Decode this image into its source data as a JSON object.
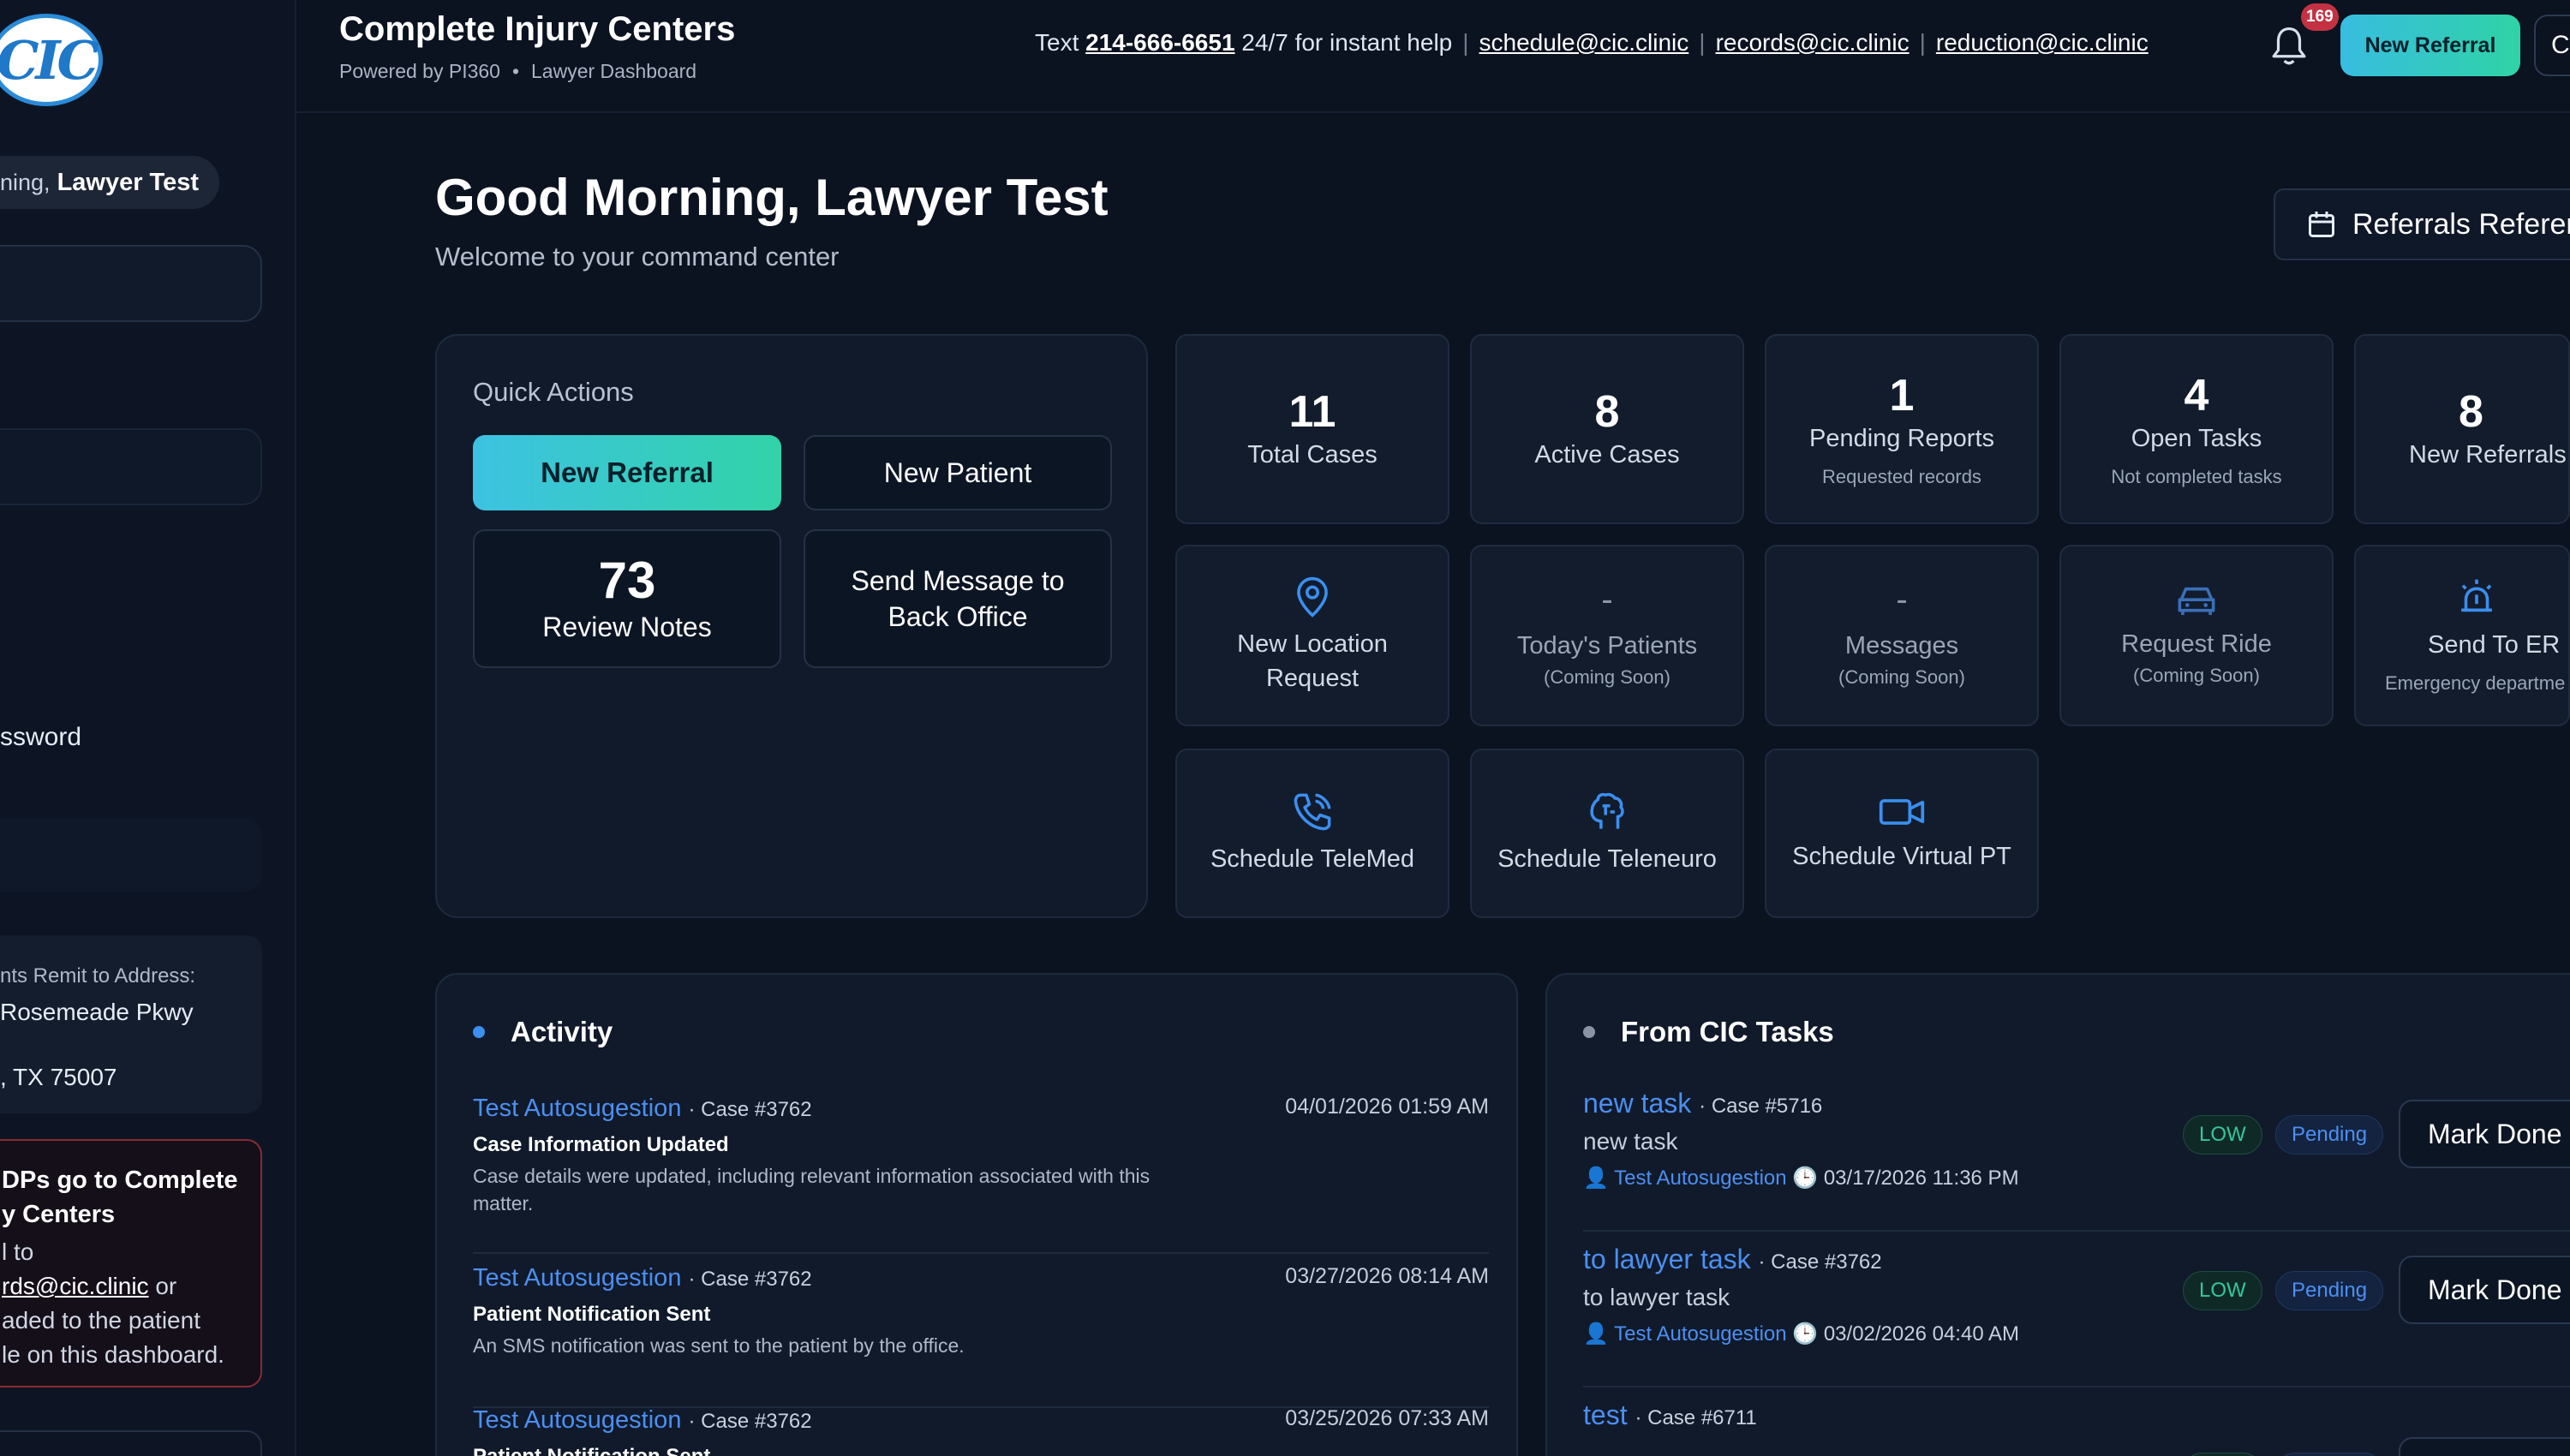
{
  "sidebar": {
    "logo_text": "CIC",
    "greeting_prefix": "ning,",
    "greeting_name": "Lawyer Test",
    "password_label": "ssword",
    "remit_label": "nts Remit to Address:",
    "remit_line1": "Rosemeade Pkwy",
    "remit_line2": ", TX 75007",
    "alert_line1": "DPs go to Complete",
    "alert_line2": "y Centers",
    "alert_line3": "l to",
    "alert_link": "rds@cic.clinic",
    "alert_line4_suffix": " or",
    "alert_line5": "aded to the patient",
    "alert_line6": "le on this dashboard."
  },
  "header": {
    "title": "Complete Injury Centers",
    "powered": "Powered by PI360",
    "dashboard": "Lawyer Dashboard",
    "text_label": "Text",
    "phone": "214-666-6651",
    "help_text": "24/7 for instant help",
    "email1": "schedule@cic.clinic",
    "email2": "records@cic.clinic",
    "email3": "reduction@cic.clinic",
    "notification_count": "169",
    "new_referral": "New Referral",
    "cut_button": "C"
  },
  "main": {
    "greeting": "Good Morning, Lawyer Test",
    "welcome": "Welcome to your command center",
    "referrals_button": "Referrals Referen"
  },
  "quick_actions": {
    "title": "Quick Actions",
    "new_referral": "New Referral",
    "new_patient": "New Patient",
    "review_count": "73",
    "review_label": "Review Notes",
    "send_message": "Send Message to Back Office"
  },
  "stats": [
    {
      "num": "11",
      "label": "Total Cases"
    },
    {
      "num": "8",
      "label": "Active Cases"
    },
    {
      "num": "1",
      "label": "Pending Reports",
      "sub": "Requested records"
    },
    {
      "num": "4",
      "label": "Open Tasks",
      "sub": "Not completed tasks"
    },
    {
      "num": "8",
      "label": "New Referrals"
    }
  ],
  "actions": {
    "location": "New Location Request",
    "todays_patients": "Today's Patients",
    "messages": "Messages",
    "request_ride": "Request Ride",
    "coming_soon": "(Coming Soon)",
    "dash": "-",
    "send_er": "Send To ER",
    "send_er_sub": "Emergency departme",
    "telemed": "Schedule TeleMed",
    "teleneuro": "Schedule Teleneuro",
    "virtual_pt": "Schedule Virtual PT"
  },
  "activity": {
    "title": "Activity",
    "items": [
      {
        "who": "Test Autosugestion",
        "case": "· Case #3762",
        "date": "04/01/2026 01:59 AM",
        "event": "Case Information Updated",
        "desc1": "Case details were updated, including relevant information associated with this",
        "desc2": "matter."
      },
      {
        "who": "Test Autosugestion",
        "case": "· Case #3762",
        "date": "03/27/2026 08:14 AM",
        "event": "Patient Notification Sent",
        "desc1": "An SMS notification was sent to the patient by the office."
      },
      {
        "who": "Test Autosugestion",
        "case": "· Case #3762",
        "date": "03/25/2026 07:33 AM",
        "event": "Patient Notification Sent"
      }
    ]
  },
  "tasks": {
    "title": "From CIC Tasks",
    "low": "LOW",
    "pending": "Pending",
    "mark_done": "Mark Done",
    "items": [
      {
        "name": "new task",
        "case": "· Case #5716",
        "desc": "new task",
        "who": "Test Autosugestion",
        "date": "03/17/2026 11:36 PM"
      },
      {
        "name": "to lawyer task",
        "case": "· Case #3762",
        "desc": "to lawyer task",
        "who": "Test Autosugestion",
        "date": "03/02/2026 04:40 AM"
      },
      {
        "name": "test",
        "case": "· Case #6711"
      }
    ]
  },
  "colors": {
    "accent_start": "#38bde0",
    "accent_end": "#2fd3a6",
    "link": "#4c8ff0",
    "badge": "#c33242"
  }
}
